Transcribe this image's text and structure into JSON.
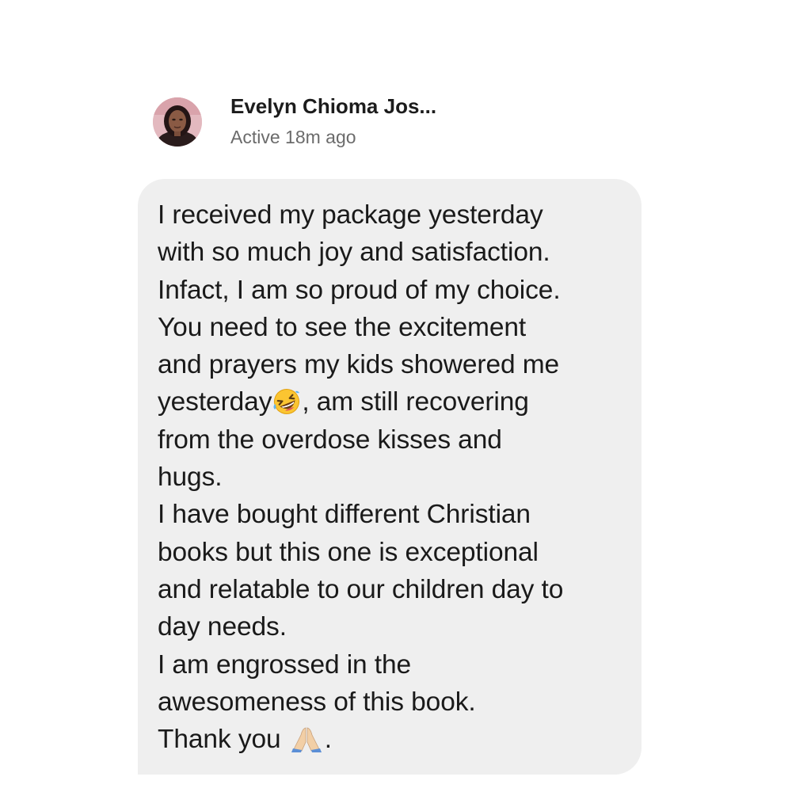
{
  "contact": {
    "name": "Evelyn Chioma Jos...",
    "status": "Active 18m ago"
  },
  "message": {
    "lines": [
      "I received my package yesterday",
      "with so much joy and satisfaction.",
      "Infact, I am so proud of my choice.",
      "You need to see the excitement",
      "and prayers my kids showered me",
      {
        "before": "yesterday",
        "emoji": "rolling-on-floor-laughing-emoji",
        "after": ", am still recovering"
      },
      "from the overdose kisses and",
      "hugs.",
      "I have bought different Christian",
      "books but this one is exceptional",
      "and relatable to our children day to",
      "day needs.",
      "I am engrossed in the",
      "awesomeness of this book.",
      {
        "before": "Thank you ",
        "emoji": "folded-hands-emoji",
        "after": "."
      }
    ]
  },
  "colors": {
    "bubble": "#efefef",
    "text": "#1a1a1a",
    "status": "#6b6b6b"
  }
}
